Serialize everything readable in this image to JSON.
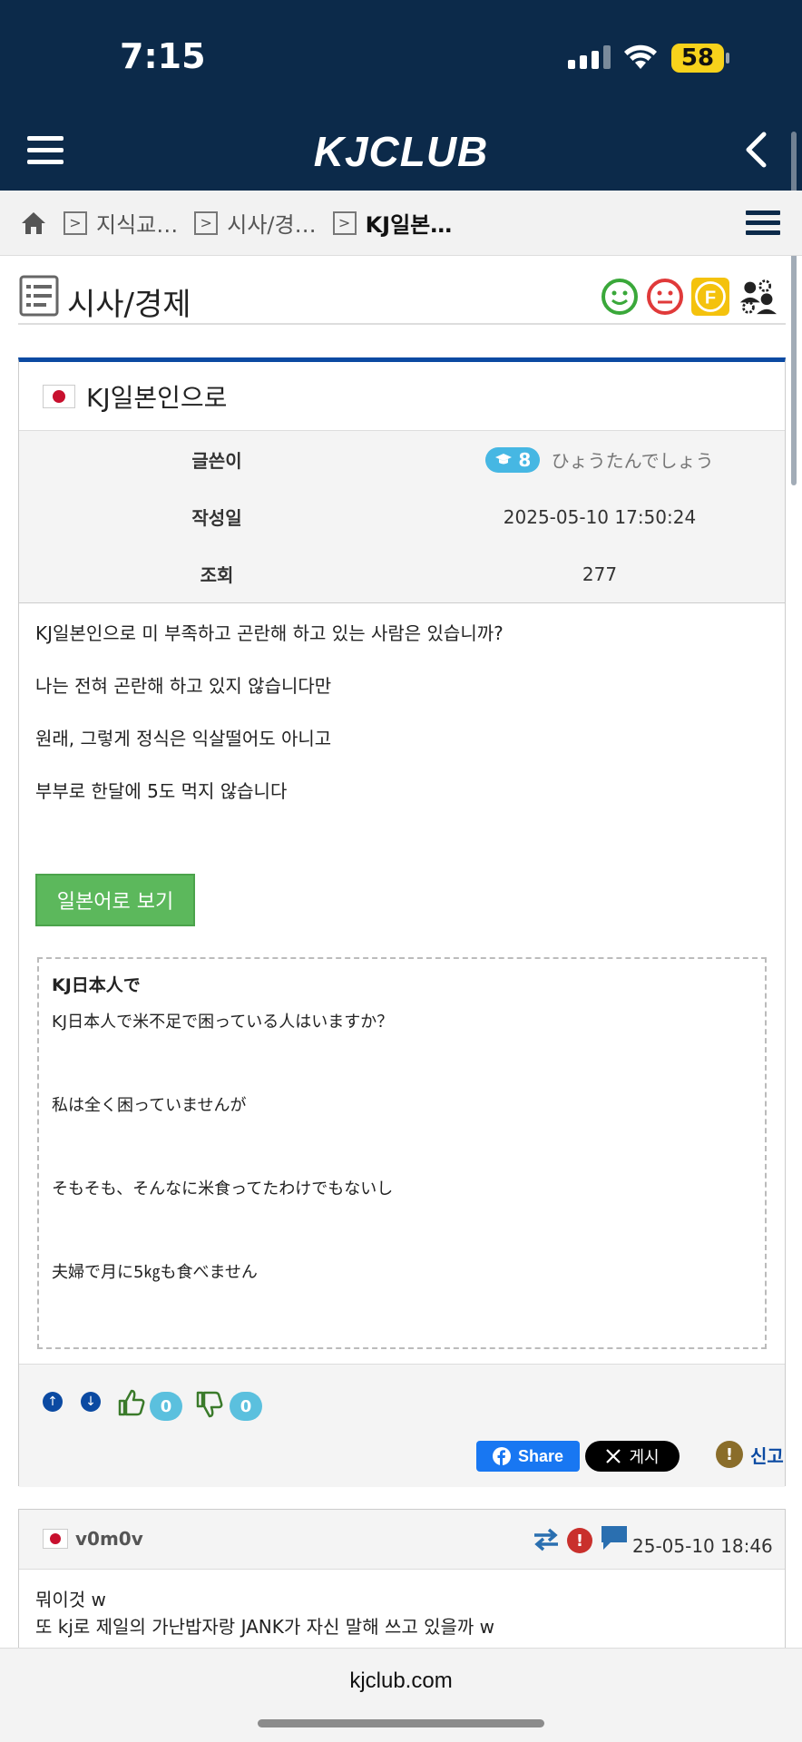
{
  "status": {
    "time": "7:15",
    "battery": "58"
  },
  "header": {
    "logo": "KJCLUB"
  },
  "breadcrumb": {
    "items": [
      "지식교…",
      "시사/경…",
      "KJ일본…"
    ]
  },
  "board": {
    "title": "시사/경제"
  },
  "post": {
    "title": "KJ일본인으로",
    "meta": {
      "author_label": "글쓴이",
      "author_level": "8",
      "author_name": "ひょうたんでしょう",
      "date_label": "작성일",
      "date": "2025-05-10 17:50:24",
      "views_label": "조회",
      "views": "277"
    },
    "body": [
      "KJ일본인으로 미 부족하고 곤란해 하고 있는 사람은 있습니까?",
      "나는 전혀 곤란해 하고 있지 않습니다만",
      "원래, 그렇게 정식은 익살떨어도 아니고",
      "부부로 한달에 5도 먹지 않습니다"
    ],
    "jp_button": "일본어로 보기",
    "jp_box": {
      "title": "KJ日本人で",
      "lines": [
        "KJ日本人で米不足で困っている人はいますか？",
        "私は全く困っていませんが",
        "そもそも、そんなに米食ってたわけでもないし",
        "夫婦で月に5㎏も食べません"
      ]
    },
    "likes": "0",
    "dislikes": "0",
    "share_label": "Share",
    "x_label": "게시",
    "report_label": "신고"
  },
  "comment": {
    "author": "v0m0v",
    "time": "25-05-10 18:46",
    "lines": [
      "뭐이것 w",
      "또 kj로 제일의 가난밥자랑 JANK가 자신 말해 쓰고 있을까 w"
    ]
  },
  "browser": {
    "url": "kjclub.com"
  },
  "colors": {
    "header_bg": "#0c2a4a",
    "post_border_top": "#0b4aa2",
    "jp_button": "#5cb85c",
    "facebook": "#1877f2",
    "badge": "#5bc0de",
    "battery": "#f7d21b"
  }
}
